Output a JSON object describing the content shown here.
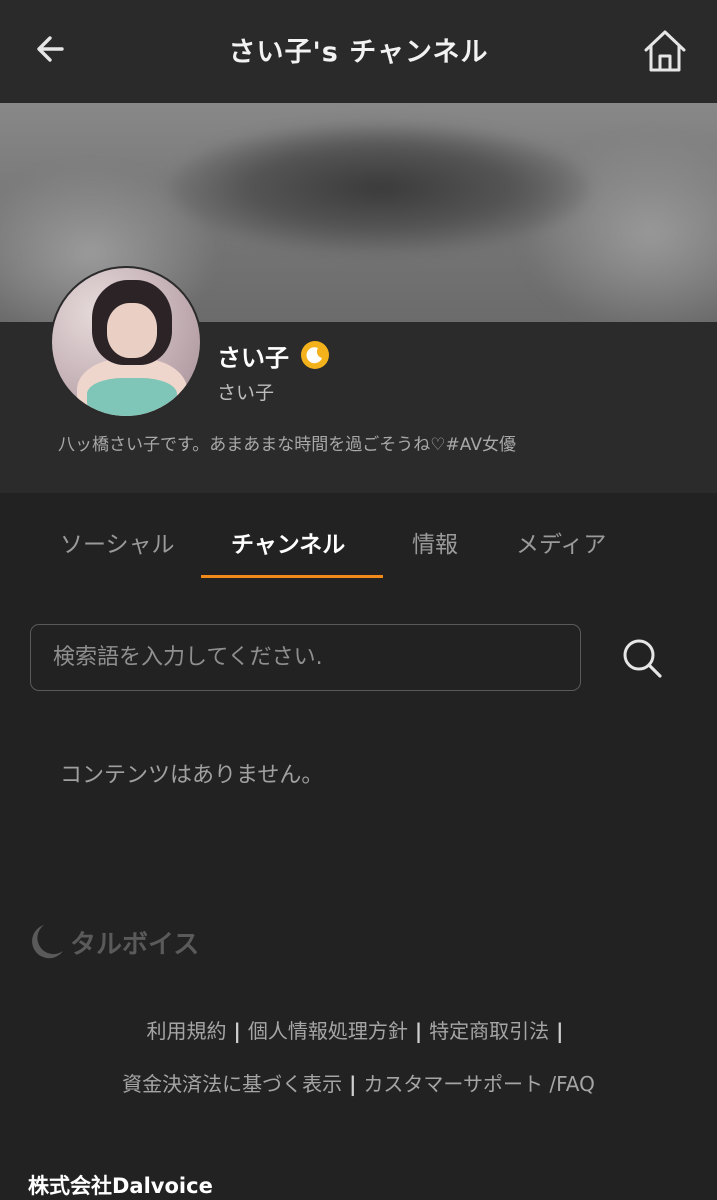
{
  "header": {
    "title": "さい子's チャンネル",
    "back_icon": "arrow-left-icon",
    "home_icon": "home-icon"
  },
  "profile": {
    "display_name": "さい子",
    "badge_icon": "moon-icon",
    "badge_color": "#f3b21b",
    "sub_name": "さい子",
    "bio": "八ッ橋さい子です。あまあまな時間を過ごそうね♡#AV女優"
  },
  "tabs": [
    {
      "label": "ソーシャル",
      "active": false
    },
    {
      "label": "チャンネル",
      "active": true
    },
    {
      "label": "情報",
      "active": false
    },
    {
      "label": "メディア",
      "active": false
    }
  ],
  "accent_color": "#f08a1a",
  "search": {
    "placeholder": "検索語を入力してください.",
    "value": "",
    "icon": "search-icon"
  },
  "empty_message": "コンテンツはありません。",
  "footer": {
    "logo_text": "タルボイス",
    "links": [
      "利用規約",
      "個人情報処理方針",
      "特定商取引法",
      "資金決済法に基づく表示",
      "カスタマーサポート /FAQ"
    ],
    "separator": "|",
    "company": "株式会社Dalvoice"
  }
}
